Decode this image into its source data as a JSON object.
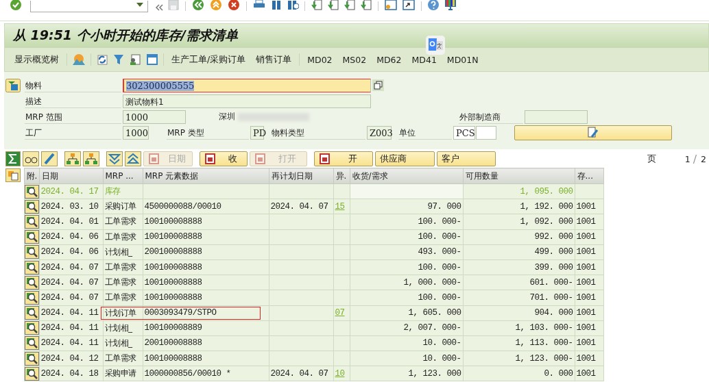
{
  "title": "从 19:51 个小时开始的库存/需求清单",
  "app_toolbar": {
    "overview": "显示概览树",
    "buttons": [
      "生产工单/采购订单",
      "销售订单",
      "MD02",
      "MS02",
      "MD62",
      "MD41",
      "MD01N"
    ]
  },
  "header": {
    "material": {
      "label": "物料",
      "value": "302300005555"
    },
    "description": {
      "label": "描述",
      "value": "测试物料1"
    },
    "mrp_area": {
      "label": "MRP 范围",
      "value": "1000",
      "text": "深圳"
    },
    "manufacturer": {
      "label": "外部制造商"
    },
    "plant": {
      "label": "工厂",
      "value": "1000"
    },
    "mrp_type": {
      "label": "MRP 类型",
      "value": "PD"
    },
    "material_type": {
      "label": "物料类型",
      "value": "Z003"
    },
    "unit": {
      "label": "单位",
      "value": "PCS"
    }
  },
  "button_bar": [
    {
      "label": "日期",
      "kind": "icon-text",
      "disabled": true
    },
    {
      "label": "收",
      "kind": "icon-text",
      "disabled": false
    },
    {
      "label": "打开",
      "kind": "icon-text",
      "disabled": true
    },
    {
      "label": "开",
      "kind": "icon-text",
      "disabled": false
    },
    {
      "label": "供应商",
      "kind": "text",
      "disabled": false
    },
    {
      "label": "客户",
      "kind": "text",
      "disabled": false
    }
  ],
  "pager": {
    "label": "页",
    "current": "1",
    "separator": "/",
    "total": "2"
  },
  "table": {
    "columns": [
      "附.",
      "日期",
      "MRP ...",
      "MRP 元素数据",
      "再计划日期",
      "异.",
      "收货/需求",
      "可用数量",
      "存..."
    ],
    "rows": [
      {
        "kind": "stock",
        "date": "2024. 04. 17",
        "mrp_element": "库存",
        "available": "1, 095. 000",
        "highlighted": false
      },
      {
        "kind": "element",
        "date": "2024. 03. 10",
        "mrp_element": "采购订单",
        "element_data": "4500000088/00010",
        "reschedule_date": "2024. 04. 07",
        "exception": "15",
        "receipt_req": "97. 000",
        "available": "1, 192. 000",
        "storage": "1001",
        "highlighted": false
      },
      {
        "kind": "element",
        "date": "2024. 04. 01",
        "mrp_element": "工单需求",
        "element_data": "100100008888",
        "receipt_req": "100. 000-",
        "available": "1, 092. 000",
        "storage": "1001",
        "highlighted": false
      },
      {
        "kind": "element",
        "date": "2024. 04. 06",
        "mrp_element": "工单需求",
        "element_data": "100100008888",
        "receipt_req": "100. 000-",
        "available": "992. 000",
        "storage": "1001",
        "highlighted": false
      },
      {
        "kind": "element",
        "date": "2024. 04. 06",
        "mrp_element": "计划相_",
        "element_data": "200100008888",
        "receipt_req": "493. 000-",
        "available": "499. 000",
        "storage": "1001",
        "highlighted": false
      },
      {
        "kind": "element",
        "date": "2024. 04. 07",
        "mrp_element": "工单需求",
        "element_data": "100100008888",
        "receipt_req": "100. 000-",
        "available": "399. 000",
        "storage": "1001",
        "highlighted": false
      },
      {
        "kind": "element",
        "date": "2024. 04. 07",
        "mrp_element": "工单需求",
        "element_data": "100100008888",
        "receipt_req": "1, 000. 000-",
        "available": "601. 000-",
        "storage": "1001",
        "highlighted": false
      },
      {
        "kind": "element",
        "date": "2024. 04. 07",
        "mrp_element": "工单需求",
        "element_data": "100100008888",
        "receipt_req": "100. 000-",
        "available": "701. 000-",
        "storage": "1001",
        "highlighted": false
      },
      {
        "kind": "element",
        "date": "2024. 04. 11",
        "mrp_element": "计划订单",
        "element_data": "0003093479/STPO",
        "exception": "07",
        "receipt_req": "1, 605. 000",
        "available": "904. 000",
        "storage": "1001",
        "highlighted": true
      },
      {
        "kind": "element",
        "date": "2024. 04. 11",
        "mrp_element": "计划相_",
        "element_data": "100100008889",
        "receipt_req": "2, 007. 000-",
        "available": "1, 103. 000-",
        "storage": "1001",
        "highlighted": false
      },
      {
        "kind": "element",
        "date": "2024. 04. 11",
        "mrp_element": "计划相_",
        "element_data": "200100008888",
        "receipt_req": "10. 000-",
        "available": "1, 113. 000-",
        "storage": "1001",
        "highlighted": false
      },
      {
        "kind": "element",
        "date": "2024. 04. 12",
        "mrp_element": "工单需求",
        "element_data": "100100008888",
        "receipt_req": "10. 000-",
        "available": "1, 123. 000-",
        "storage": "1001",
        "highlighted": false
      },
      {
        "kind": "element",
        "date": "2024. 04. 18",
        "mrp_element": "采购申请",
        "element_data": "1000000856/00010 *",
        "reschedule_date": "2024. 04. 07",
        "exception": "10",
        "receipt_req": "1, 123. 000",
        "available": "0. 000",
        "storage": "1001",
        "highlighted": false
      }
    ]
  }
}
